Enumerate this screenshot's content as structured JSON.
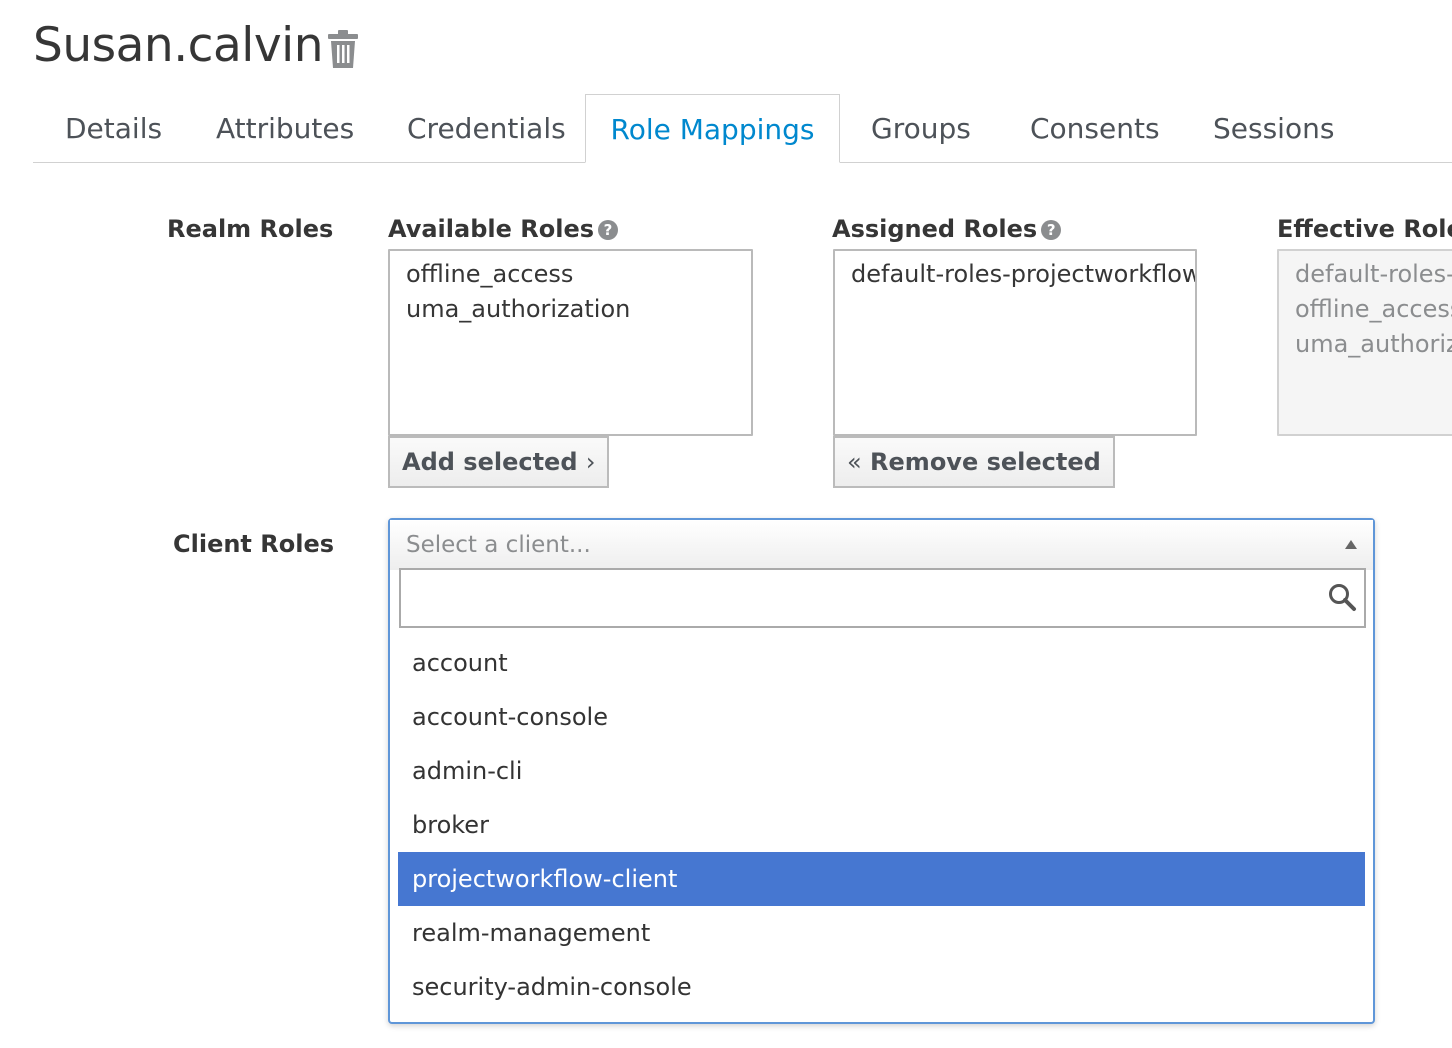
{
  "header": {
    "title": "Susan.calvin"
  },
  "tabs": [
    "Details",
    "Attributes",
    "Credentials",
    "Role Mappings",
    "Groups",
    "Consents",
    "Sessions"
  ],
  "active_tab": "Role Mappings",
  "realm_roles": {
    "label": "Realm Roles",
    "available": {
      "label": "Available Roles",
      "items": [
        "offline_access",
        "uma_authorization"
      ]
    },
    "assigned": {
      "label": "Assigned Roles",
      "items": [
        "default-roles-projectworkflow"
      ]
    },
    "effective": {
      "label": "Effective Roles",
      "items": [
        "default-roles-p",
        "offline_access",
        "uma_authoriza"
      ]
    },
    "add_button": "Add selected",
    "remove_button": "Remove selected"
  },
  "client_roles": {
    "label": "Client Roles",
    "placeholder": "Select a client...",
    "search_value": "",
    "options": [
      "account",
      "account-console",
      "admin-cli",
      "broker",
      "projectworkflow-client",
      "realm-management",
      "security-admin-console"
    ],
    "highlighted": "projectworkflow-client"
  },
  "colors": {
    "accent": "#0088ce",
    "highlight": "#4677d1",
    "select_border": "#5f96d8"
  },
  "icons": {
    "delete": "trash-icon",
    "help": "question-circle-icon",
    "search": "search-icon",
    "dropdown": "caret-up-icon"
  }
}
